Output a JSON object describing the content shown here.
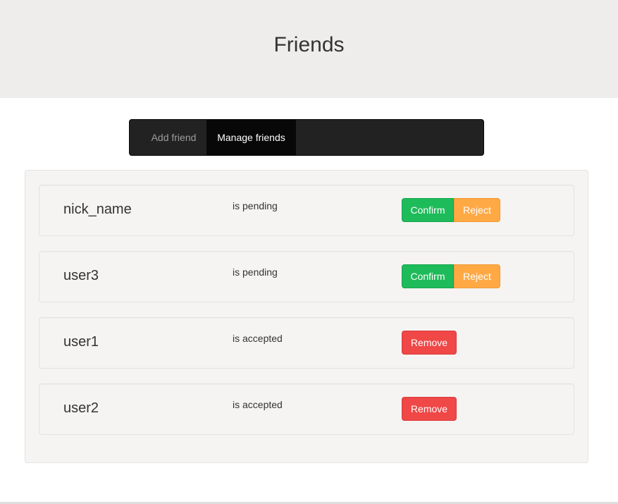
{
  "header": {
    "title": "Friends"
  },
  "nav": {
    "items": [
      {
        "label": "Add friend",
        "active": false
      },
      {
        "label": "Manage friends",
        "active": true
      }
    ]
  },
  "friends": [
    {
      "name": "nick_name",
      "status": "is pending",
      "actions": [
        "Confirm",
        "Reject"
      ]
    },
    {
      "name": "user3",
      "status": "is pending",
      "actions": [
        "Confirm",
        "Reject"
      ]
    },
    {
      "name": "user1",
      "status": "is accepted",
      "actions": [
        "Remove"
      ]
    },
    {
      "name": "user2",
      "status": "is accepted",
      "actions": [
        "Remove"
      ]
    }
  ],
  "colors": {
    "confirm": "#1ebb5a",
    "reject": "#ffa945",
    "remove": "#f04747",
    "navbar": "#222222",
    "header_bg": "#eeedeb"
  }
}
